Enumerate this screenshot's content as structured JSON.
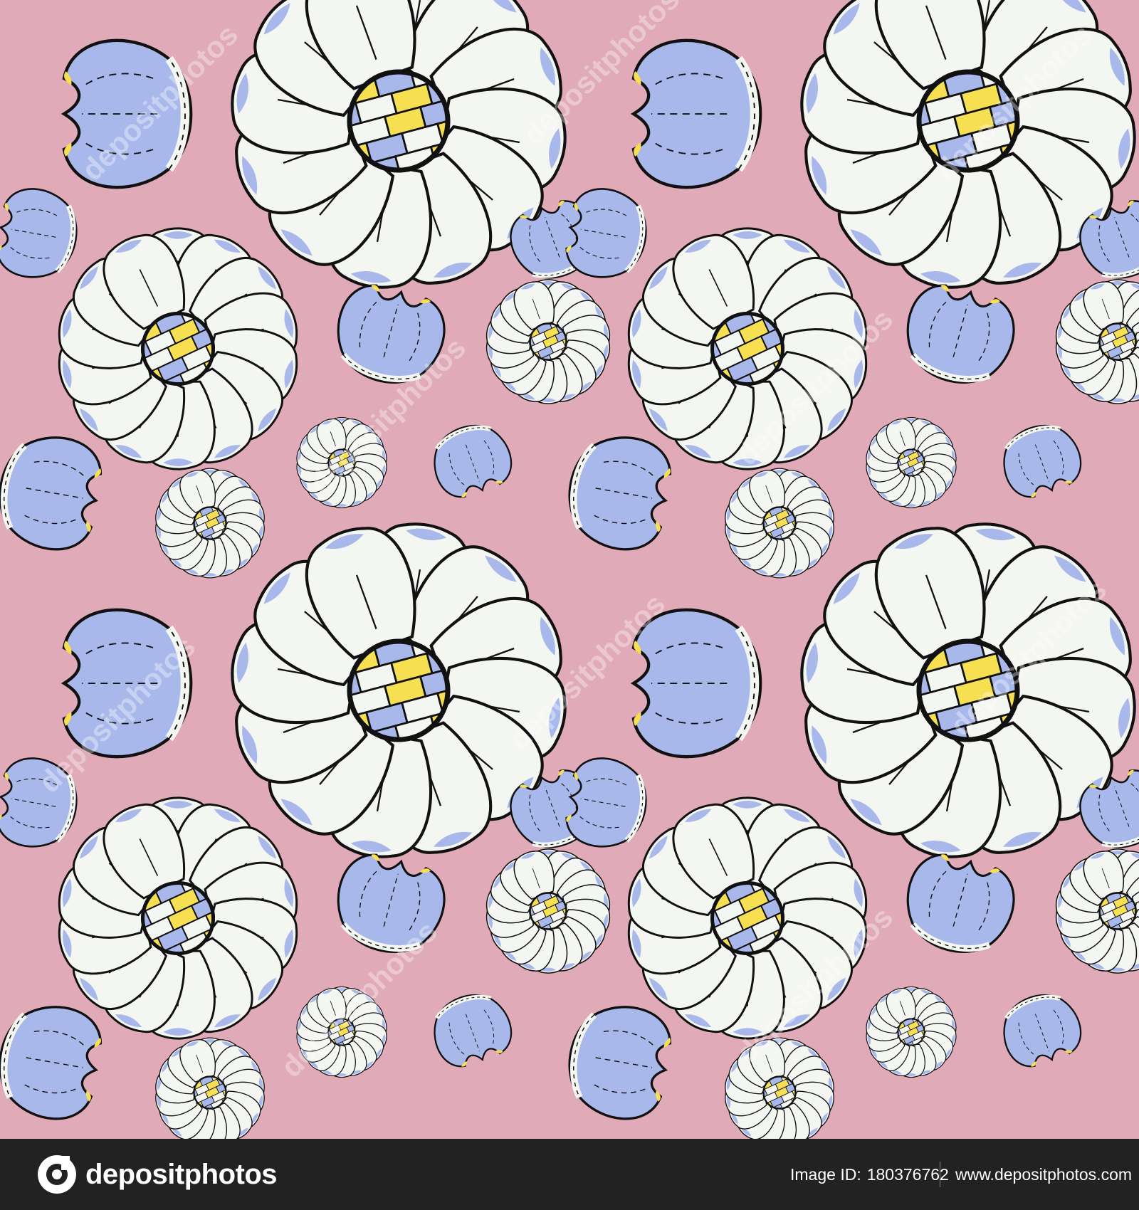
{
  "image": {
    "description_tag": "seamless floral pattern",
    "colors": {
      "background": "#e0aab9",
      "petal_white": "#f4f6f2",
      "petal_blue": "#a9b8ea",
      "center_yellow": "#f7df52",
      "center_blue": "#a9b8ea",
      "outline": "#111111",
      "footer_background": "#222222"
    }
  },
  "watermark": {
    "text": "depositphotos"
  },
  "footer": {
    "logo_text": "depositphotos",
    "image_id_label": "Image ID:",
    "image_id_value": "180376762",
    "url": "www.depositphotos.com"
  }
}
